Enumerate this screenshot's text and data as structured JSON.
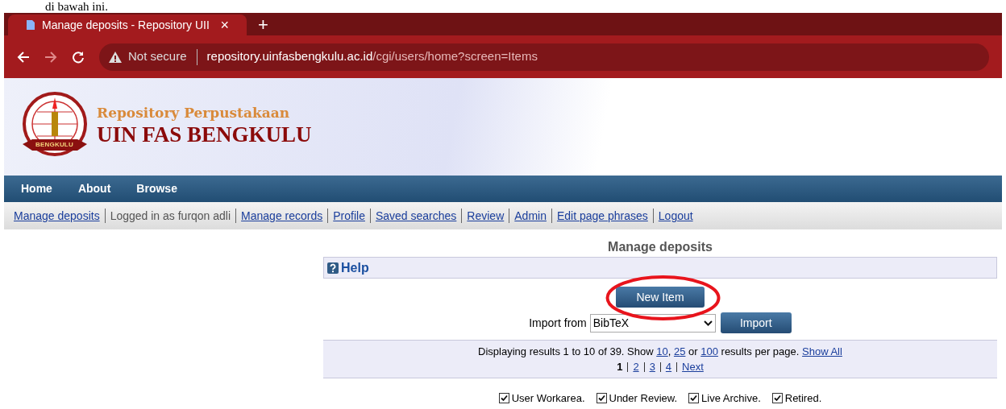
{
  "document_caption": "di bawah ini.",
  "browser": {
    "tab": {
      "title": "Manage deposits - Repository UII",
      "close": "×"
    },
    "new_tab": "+",
    "security": "Not secure",
    "url_host": "repository.uinfasbengkulu.ac.id",
    "url_path": "/cgi/users/home?screen=Items"
  },
  "banner": {
    "emblem_ribbon": "BENGKULU",
    "title_line_1": "Repository Perpustakaan",
    "title_line_2": "UIN FAS BENGKULU"
  },
  "nav": [
    "Home",
    "About",
    "Browse"
  ],
  "user_menu": [
    {
      "kind": "link",
      "label": "Manage deposits"
    },
    {
      "kind": "text",
      "label": "Logged in as furqon adli"
    },
    {
      "kind": "link",
      "label": "Manage records"
    },
    {
      "kind": "link",
      "label": "Profile"
    },
    {
      "kind": "link",
      "label": "Saved searches"
    },
    {
      "kind": "link",
      "label": "Review"
    },
    {
      "kind": "link",
      "label": "Admin"
    },
    {
      "kind": "link",
      "label": "Edit page phrases"
    },
    {
      "kind": "link",
      "label": "Logout"
    }
  ],
  "page_title": "Manage deposits",
  "help": "Help",
  "new_item_button": "New Item",
  "import": {
    "label": "Import from",
    "value": "BibTeX",
    "button": "Import"
  },
  "results": {
    "prefix": "Displaying results 1 to 10 of 39. Show",
    "sizes": [
      "10",
      "25",
      "100"
    ],
    "sep": ",",
    "or": "or",
    "suffix": "results per page.",
    "show_all": "Show All"
  },
  "pagination": [
    {
      "kind": "current",
      "label": "1"
    },
    {
      "kind": "link",
      "label": "2"
    },
    {
      "kind": "link",
      "label": "3"
    },
    {
      "kind": "link",
      "label": "4"
    },
    {
      "kind": "link",
      "label": "Next"
    }
  ],
  "filters": [
    {
      "label": "User Workarea.",
      "checked": true
    },
    {
      "label": "Under Review.",
      "checked": true
    },
    {
      "label": "Live Archive.",
      "checked": true
    },
    {
      "label": "Retired.",
      "checked": true
    }
  ]
}
